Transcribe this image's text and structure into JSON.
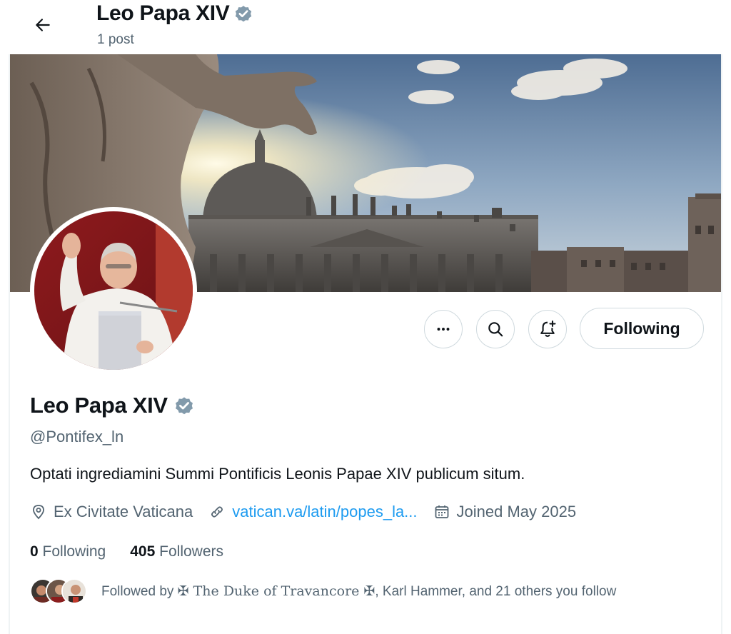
{
  "header": {
    "name": "Leo Papa XIV",
    "posts": "1 post"
  },
  "icons": {
    "back": "arrow-left-icon",
    "verified": "verified-badge-icon",
    "more": "more-dots-icon",
    "search": "search-icon",
    "notify": "bell-plus-icon",
    "location": "location-pin-icon",
    "link": "link-icon",
    "calendar": "calendar-icon"
  },
  "actions": {
    "follow_label": "Following"
  },
  "profile": {
    "name": "Leo Papa XIV",
    "handle": "@Pontifex_ln",
    "bio": "Optati ingrediamini Summi Pontificis Leonis Papae XIV publicum situm.",
    "location": "Ex Civitate Vaticana",
    "link": "vatican.va/latin/popes_la...",
    "joined": "Joined May 2025"
  },
  "stats": {
    "following_count": "0",
    "following_label": "Following",
    "followers_count": "405",
    "followers_label": "Followers"
  },
  "followed_by": {
    "prefix": "Followed by ",
    "name1": "✠ The Duke of Travancore ✠",
    "suffix": ", Karl Hammer, and 21 others you follow"
  },
  "colors": {
    "text": "#0f1419",
    "secondary": "#536471",
    "link": "#1d9bf0",
    "border": "#cfd9de",
    "verified": "#829aab"
  }
}
